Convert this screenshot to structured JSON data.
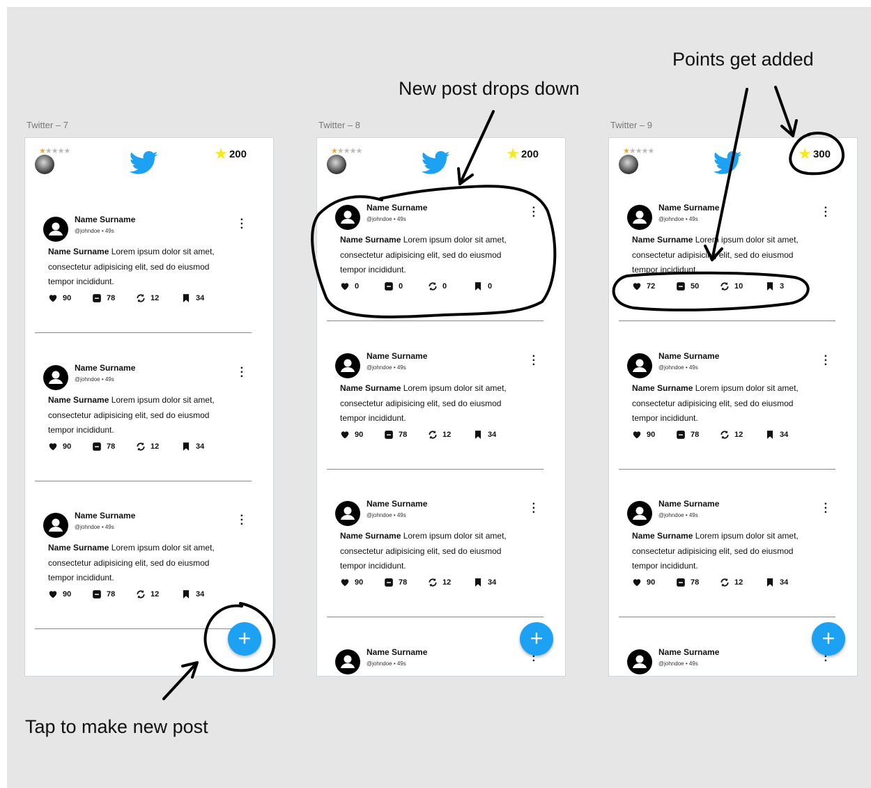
{
  "frames": [
    {
      "label": "Twitter – 7",
      "points": "200",
      "posts": [
        {
          "name": "Name Surname",
          "handle": "@johndoe • 49s",
          "body_bold": "Name Surname",
          "body_rest": " Lorem ipsum dolor sit amet, consectetur adipisicing elit, sed do eiusmod tempor incididunt.",
          "likes": "90",
          "comments": "78",
          "retweets": "12",
          "bookmarks": "34"
        },
        {
          "name": "Name Surname",
          "handle": "@johndoe • 49s",
          "body_bold": "Name Surname",
          "body_rest": " Lorem ipsum dolor sit amet, consectetur adipisicing elit, sed do eiusmod tempor incididunt.",
          "likes": "90",
          "comments": "78",
          "retweets": "12",
          "bookmarks": "34"
        },
        {
          "name": "Name Surname",
          "handle": "@johndoe • 49s",
          "body_bold": "Name Surname",
          "body_rest": " Lorem ipsum dolor sit amet, consectetur adipisicing elit, sed do eiusmod tempor incididunt.",
          "likes": "90",
          "comments": "78",
          "retweets": "12",
          "bookmarks": "34"
        }
      ],
      "fab": "+"
    },
    {
      "label": "Twitter – 8",
      "points": "200",
      "posts": [
        {
          "name": "Name Surname",
          "handle": "@johndoe • 49s",
          "body_bold": "Name Surname",
          "body_rest": " Lorem ipsum dolor sit amet, consectetur adipisicing elit, sed do eiusmod tempor incididunt.",
          "likes": "0",
          "comments": "0",
          "retweets": "0",
          "bookmarks": "0"
        },
        {
          "name": "Name Surname",
          "handle": "@johndoe • 49s",
          "body_bold": "Name Surname",
          "body_rest": " Lorem ipsum dolor sit amet, consectetur adipisicing elit, sed do eiusmod tempor incididunt.",
          "likes": "90",
          "comments": "78",
          "retweets": "12",
          "bookmarks": "34"
        },
        {
          "name": "Name Surname",
          "handle": "@johndoe • 49s",
          "body_bold": "Name Surname",
          "body_rest": " Lorem ipsum dolor sit amet, consectetur adipisicing elit, sed do eiusmod tempor incididunt.",
          "likes": "90",
          "comments": "78",
          "retweets": "12",
          "bookmarks": "34"
        },
        {
          "name": "Name Surname",
          "handle": "@johndoe • 49s"
        }
      ],
      "fab": "+"
    },
    {
      "label": "Twitter – 9",
      "points": "300",
      "posts": [
        {
          "name": "Name Surname",
          "handle": "@johndoe • 49s",
          "body_bold": "Name Surname",
          "body_rest": " Lorem ipsum dolor sit amet, consectetur adipisicing elit, sed do eiusmod tempor incididunt.",
          "likes": "72",
          "comments": "50",
          "retweets": "10",
          "bookmarks": "3"
        },
        {
          "name": "Name Surname",
          "handle": "@johndoe • 49s",
          "body_bold": "Name Surname",
          "body_rest": " Lorem ipsum dolor sit amet, consectetur adipisicing elit, sed do eiusmod tempor incididunt.",
          "likes": "90",
          "comments": "78",
          "retweets": "12",
          "bookmarks": "34"
        },
        {
          "name": "Name Surname",
          "handle": "@johndoe • 49s",
          "body_bold": "Name Surname",
          "body_rest": " Lorem ipsum dolor sit amet, consectetur adipisicing elit, sed do eiusmod tempor incididunt.",
          "likes": "90",
          "comments": "78",
          "retweets": "12",
          "bookmarks": "34"
        },
        {
          "name": "Name Surname",
          "handle": "@johndoe • 49s"
        }
      ],
      "fab": "+"
    }
  ],
  "annotations": {
    "new_post": "New post drops down",
    "points": "Points get added",
    "tap": "Tap to make new post"
  },
  "colors": {
    "accent": "#1da1f2",
    "star": "#f8e71c",
    "crown": "#f5a623",
    "canvas": "#e6e6e6"
  },
  "icons": [
    "heart-icon",
    "comment-icon",
    "retweet-icon",
    "bookmark-icon",
    "more-vert-icon",
    "twitter-bird-icon",
    "star-icon",
    "avatar-icon",
    "plus-icon"
  ]
}
